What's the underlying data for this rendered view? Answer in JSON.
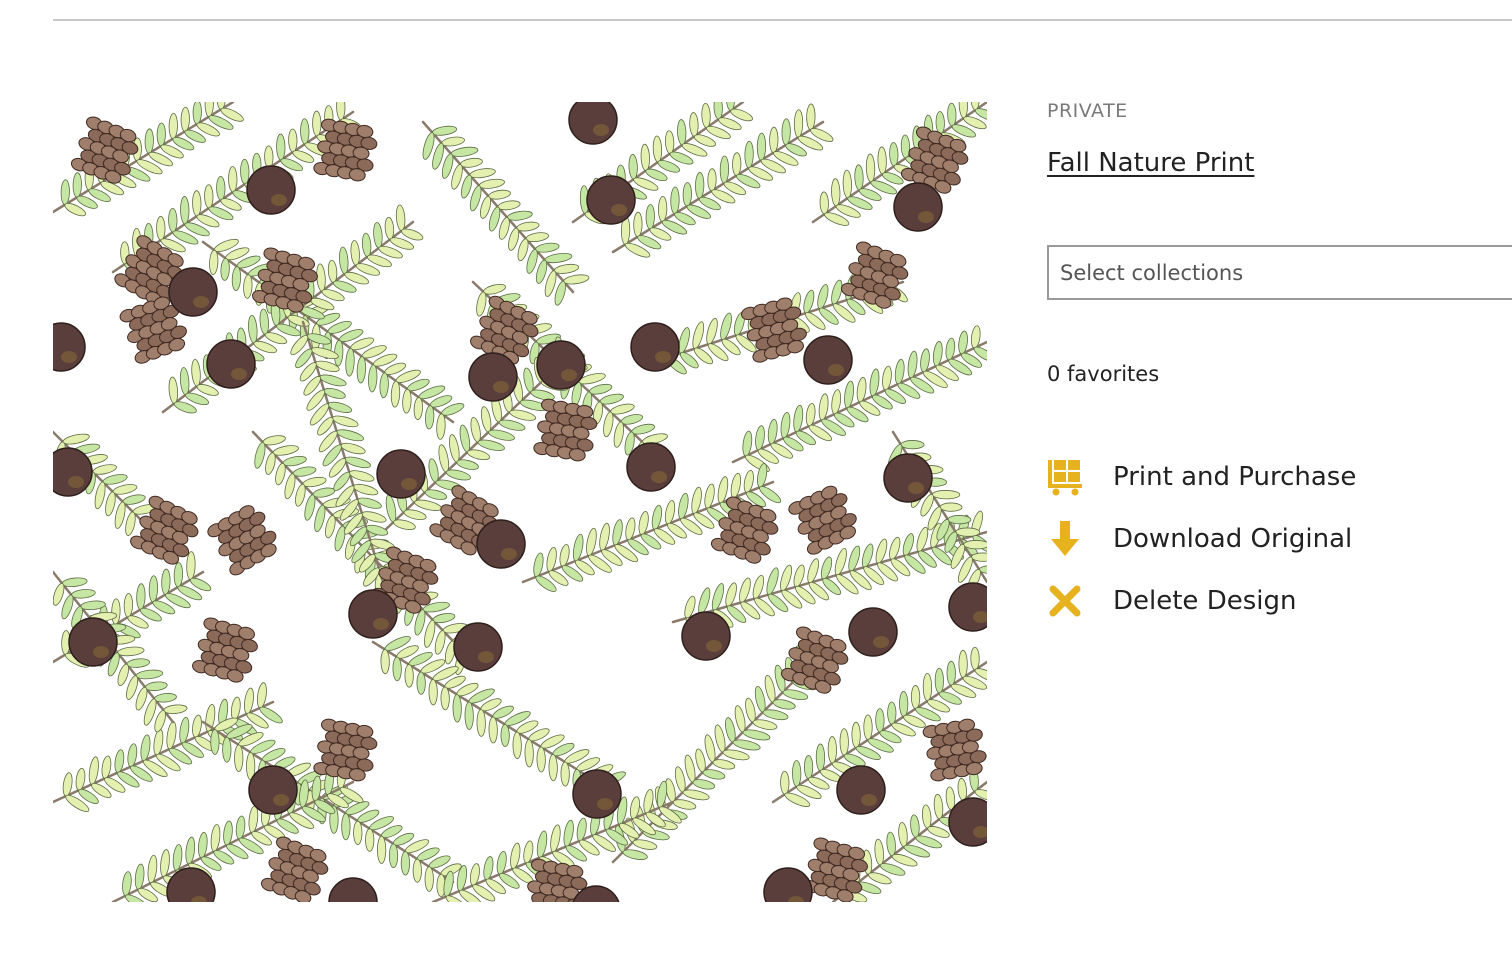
{
  "design": {
    "privacy": "PRIVATE",
    "title": "Fall Nature Print",
    "image_alt": "Fall nature pattern of hemlock branches, pine cones and acorns"
  },
  "collections": {
    "placeholder": "Select collections"
  },
  "favorites": {
    "label": "0 favorites"
  },
  "actions": [
    {
      "label": "Print and Purchase",
      "icon": "cart-icon"
    },
    {
      "label": "Download Original",
      "icon": "download-arrow-icon"
    },
    {
      "label": "Delete Design",
      "icon": "delete-x-icon"
    }
  ],
  "colors": {
    "accent": "#e6b31e",
    "text": "#222222",
    "muted": "#7a7a7a",
    "border": "#9a9a9a",
    "rule": "#c8c8c8"
  }
}
